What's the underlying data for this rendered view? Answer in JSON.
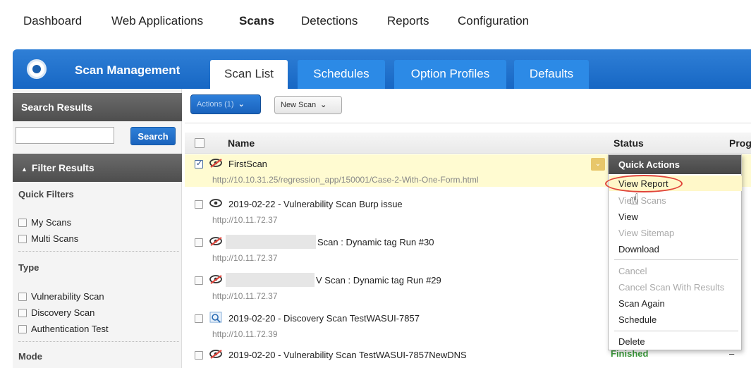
{
  "nav": {
    "items": [
      "Dashboard",
      "Web Applications",
      "Scans",
      "Detections",
      "Reports",
      "Configuration"
    ],
    "active": "Scans"
  },
  "header": {
    "title": "Scan Management",
    "tabs": [
      "Scan List",
      "Schedules",
      "Option Profiles",
      "Defaults"
    ],
    "active_tab": "Scan List"
  },
  "sidebar": {
    "search_results_title": "Search Results",
    "search_input_value": "",
    "search_button": "Search",
    "filter_results_title": "Filter Results",
    "filter_results_icon": "triangle-up-icon",
    "quick_filters_label": "Quick Filters",
    "quick_filters": [
      "My Scans",
      "Multi Scans"
    ],
    "type_label": "Type",
    "types": [
      "Vulnerability Scan",
      "Discovery Scan",
      "Authentication Test"
    ],
    "mode_label": "Mode"
  },
  "toolbar": {
    "actions_label": "Actions (1)",
    "new_scan_label": "New Scan"
  },
  "table": {
    "columns": [
      "Name",
      "Status",
      "Prog"
    ],
    "rows": [
      {
        "name": "FirstScan",
        "url": "http://10.10.31.25/regression_app/150001/Case-2-With-One-Form.html",
        "checked": true,
        "icon": "eye-crossed-icon"
      },
      {
        "name": "2019-02-22 - Vulnerability Scan Burp issue",
        "url": "http://10.11.72.37",
        "checked": false,
        "icon": "eye-icon"
      },
      {
        "name": "Scan : Dynamic tag Run #30",
        "url": "http://10.11.72.37",
        "checked": false,
        "icon": "eye-crossed-icon"
      },
      {
        "name": "V Scan : Dynamic tag Run #29",
        "url": "http://10.11.72.37",
        "checked": false,
        "icon": "eye-crossed-icon"
      },
      {
        "name": "2019-02-20 - Discovery Scan TestWASUI-7857",
        "url": "http://10.11.72.39",
        "checked": false,
        "icon": "discovery-scan-icon"
      },
      {
        "name": "2019-02-20 - Vulnerability Scan TestWASUI-7857NewDNS",
        "url": "",
        "checked": false,
        "icon": "eye-crossed-icon"
      }
    ],
    "last_row_status": "Finished",
    "last_row_progress": "–"
  },
  "quick_actions": {
    "title": "Quick Actions",
    "items": [
      {
        "label": "View Report",
        "enabled": true
      },
      {
        "label": "View Scans",
        "enabled": false
      },
      {
        "label": "View",
        "enabled": true
      },
      {
        "label": "View Sitemap",
        "enabled": false
      },
      {
        "label": "Download",
        "enabled": true
      },
      {
        "label": "Cancel",
        "enabled": false
      },
      {
        "label": "Cancel Scan With Results",
        "enabled": false
      },
      {
        "label": "Scan Again",
        "enabled": true
      },
      {
        "label": "Schedule",
        "enabled": true
      },
      {
        "label": "Delete",
        "enabled": true
      }
    ]
  },
  "colors": {
    "brand_blue": "#1767c4",
    "selected_row": "#fffbd1",
    "finished_green": "#3b9a3b",
    "highlight_red": "#e0443a"
  }
}
